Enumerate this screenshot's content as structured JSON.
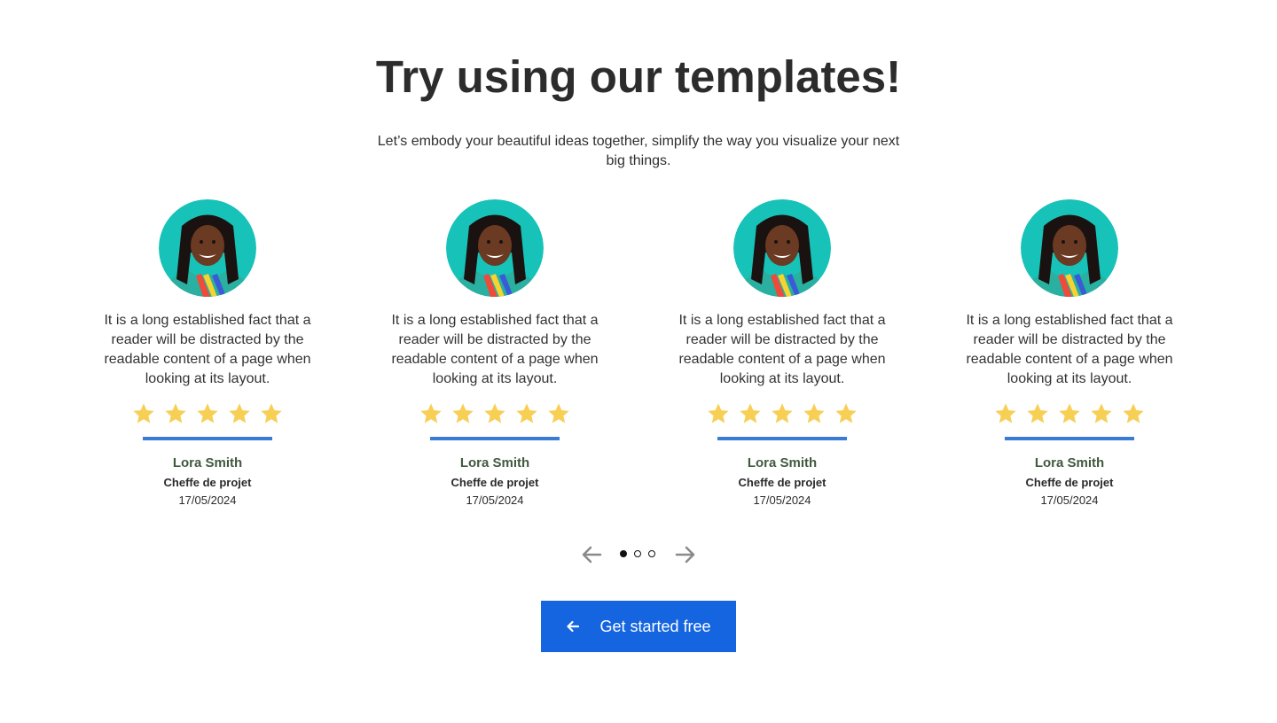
{
  "header": {
    "title": "Try using our templates!",
    "subtitle": "Let’s embody your beautiful ideas together, simplify the way you visualize your next big things."
  },
  "testimonials": [
    {
      "quote": "It is a long established fact that a reader will be distracted by the readable content of a page when looking at its layout.",
      "rating": 5,
      "name": "Lora Smith",
      "role": "Cheffe de projet",
      "date": "17/05/2024"
    },
    {
      "quote": "It is a long established fact that a reader will be distracted by the readable content of a page when looking at its layout.",
      "rating": 5,
      "name": "Lora Smith",
      "role": "Cheffe de projet",
      "date": "17/05/2024"
    },
    {
      "quote": "It is a long established fact that a reader will be distracted by the readable content of a page when looking at its layout.",
      "rating": 5,
      "name": "Lora Smith",
      "role": "Cheffe de projet",
      "date": "17/05/2024"
    },
    {
      "quote": "It is a long established fact that a reader will be distracted by the readable content of a page when looking at its layout.",
      "rating": 5,
      "name": "Lora Smith",
      "role": "Cheffe de projet",
      "date": "17/05/2024"
    }
  ],
  "pagination": {
    "page_count": 3,
    "active_page": 1,
    "prev_icon": "arrow-left-icon",
    "next_icon": "arrow-right-icon"
  },
  "cta": {
    "label": "Get started free",
    "icon": "arrow-left-icon"
  },
  "colors": {
    "accent": "#1565e0",
    "divider": "#3a7bd5",
    "star": "#f7cf55",
    "name": "#3f5a3e",
    "avatar_bg": "#17c2b8"
  }
}
